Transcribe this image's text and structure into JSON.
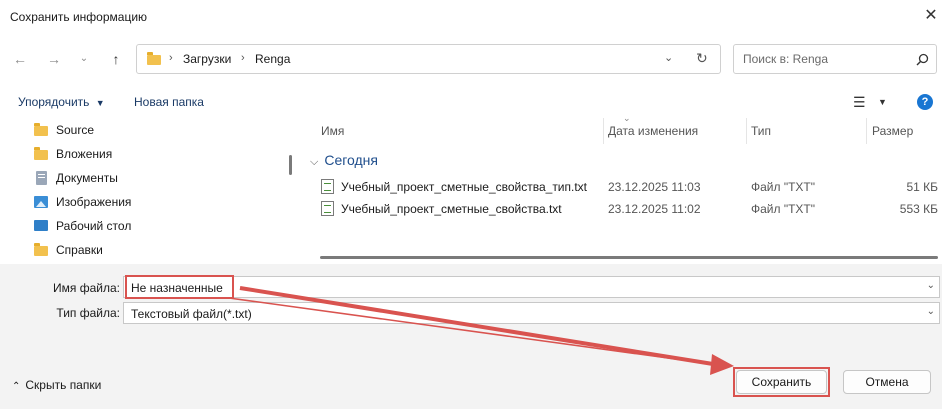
{
  "window": {
    "title": "Сохранить информацию"
  },
  "nav": {
    "breadcrumb": [
      "Загрузки",
      "Renga"
    ],
    "search_placeholder": "Поиск в: Renga"
  },
  "toolbar": {
    "organize_label": "Упорядочить",
    "new_folder_label": "Новая папка",
    "help_label": "?"
  },
  "sidebar": {
    "items": [
      {
        "label": "Source",
        "icon": "folder-icon"
      },
      {
        "label": "Вложения",
        "icon": "folder-icon"
      },
      {
        "label": "Документы",
        "icon": "documents-icon"
      },
      {
        "label": "Изображения",
        "icon": "pictures-icon"
      },
      {
        "label": "Рабочий стол",
        "icon": "desktop-icon"
      },
      {
        "label": "Справки",
        "icon": "folder-icon"
      }
    ]
  },
  "files": {
    "columns": {
      "name": "Имя",
      "date": "Дата изменения",
      "type": "Тип",
      "size": "Размер"
    },
    "group": "Сегодня",
    "rows": [
      {
        "name": "Учебный_проект_сметные_свойства_тип.txt",
        "date": "23.12.2025 11:03",
        "type": "Файл \"TXT\"",
        "size": "51 КБ"
      },
      {
        "name": "Учебный_проект_сметные_свойства.txt",
        "date": "23.12.2025 11:02",
        "type": "Файл \"TXT\"",
        "size": "553 КБ"
      }
    ]
  },
  "form": {
    "filename_label": "Имя файла:",
    "filename_value": "Не назначенные",
    "filetype_label": "Тип файла:",
    "filetype_value": "Текстовый файл(*.txt)"
  },
  "footer": {
    "hide_folders": "Скрыть папки",
    "save_label": "Сохранить",
    "cancel_label": "Отмена"
  },
  "colors": {
    "annotation": "#d9534f",
    "accent": "#1976d2",
    "group_header": "#1f4e8c"
  }
}
